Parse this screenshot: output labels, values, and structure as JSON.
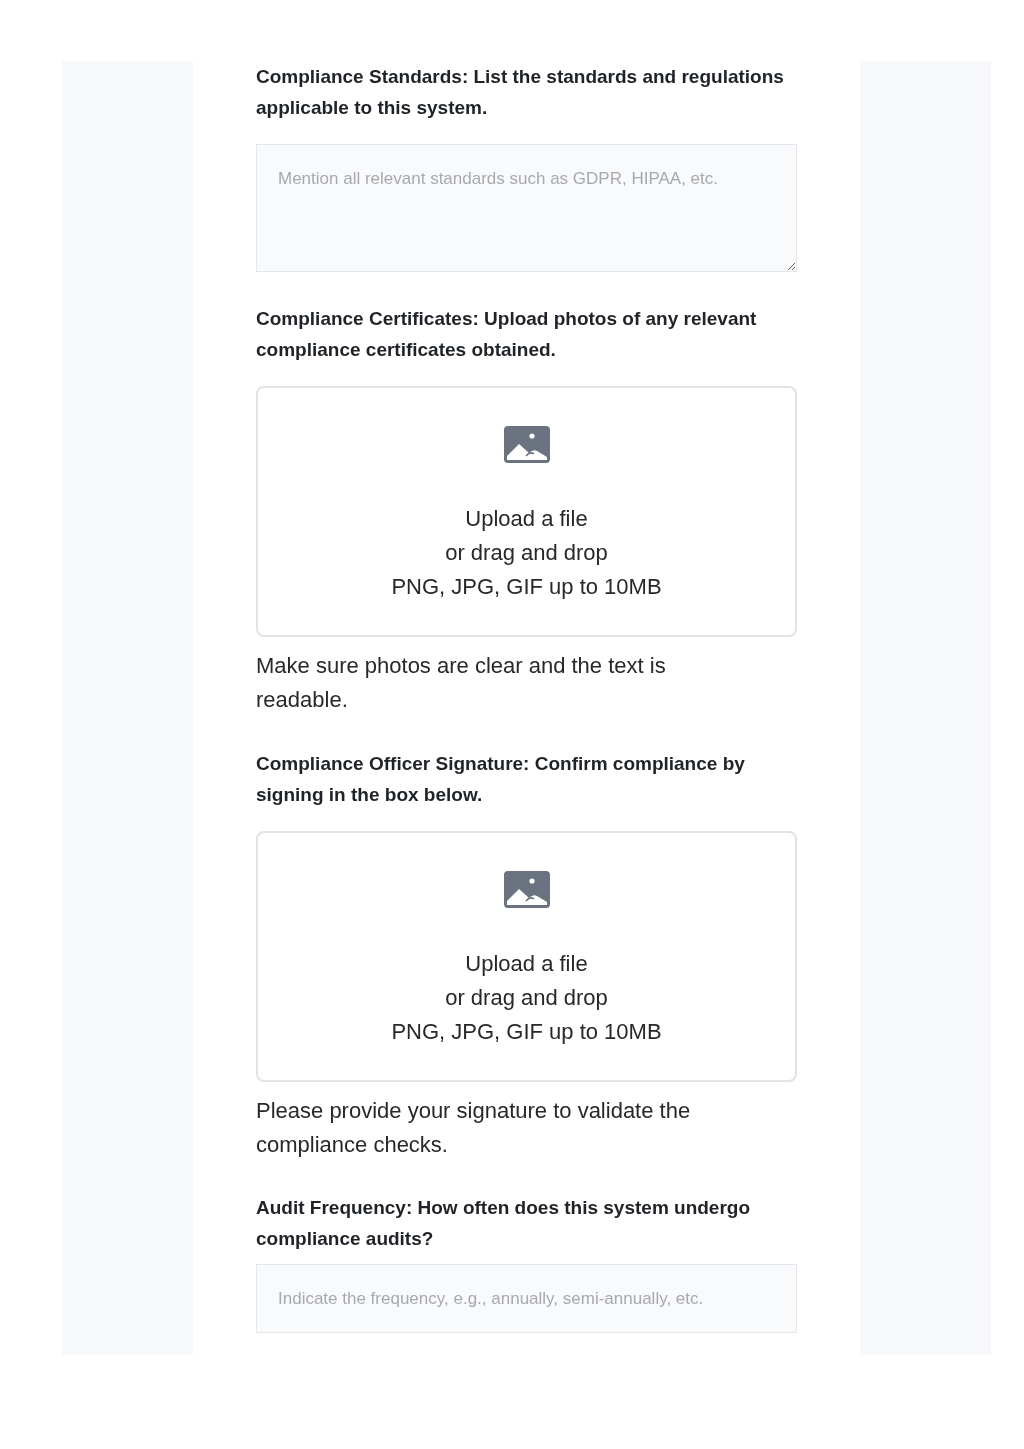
{
  "form": {
    "fields": [
      {
        "kind": "textarea",
        "label": "Compliance Standards: List the standards and regulations applicable to this system.",
        "placeholder": "Mention all relevant standards such as GDPR, HIPAA, etc."
      },
      {
        "kind": "upload",
        "label": "Compliance Certificates: Upload photos of any relevant compliance certificates obtained.",
        "upload": {
          "link": "Upload a file",
          "text": "or drag and drop",
          "hint": "PNG, JPG, GIF up to 10MB"
        },
        "help": "Make sure photos are clear and the text is readable."
      },
      {
        "kind": "upload",
        "label": "Compliance Officer Signature: Confirm compliance by signing in the box below.",
        "upload": {
          "link": "Upload a file",
          "text": "or drag and drop",
          "hint": "PNG, JPG, GIF up to 10MB"
        },
        "help": "Please provide your signature to validate the compliance checks."
      },
      {
        "kind": "input",
        "label": "Audit Frequency: How often does this system undergo compliance audits?",
        "placeholder": "Indicate the frequency, e.g., annually, semi-annually, etc."
      }
    ]
  }
}
